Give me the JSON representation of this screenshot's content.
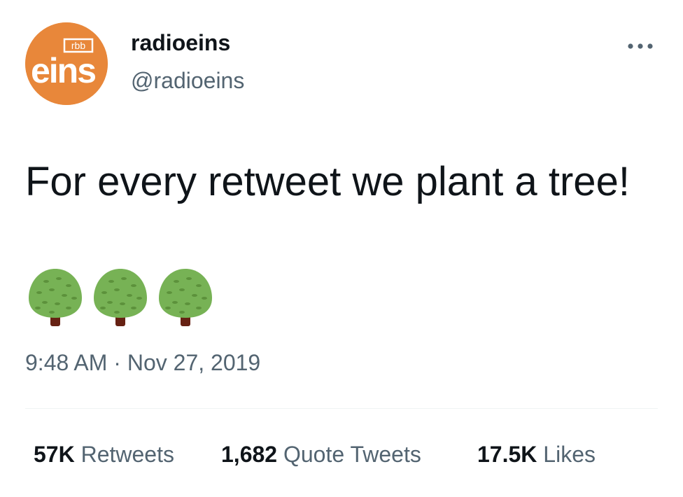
{
  "tweet": {
    "avatar_label": "radioeins logo",
    "avatar_small_text": "rbb",
    "avatar_text": "eins",
    "display_name": "radioeins",
    "handle": "@radioeins",
    "more_icon": "more-horizontal-icon",
    "text": "For every retweet we plant a tree!",
    "emojis": [
      "tree-icon",
      "tree-icon",
      "tree-icon"
    ],
    "time": "9:48 AM",
    "separator": "·",
    "date": "Nov 27, 2019"
  },
  "stats": {
    "retweets": {
      "count": "57K",
      "label": "Retweets"
    },
    "quote_tweets": {
      "count": "1,682",
      "label": "Quote Tweets"
    },
    "likes": {
      "count": "17.5K",
      "label": "Likes"
    }
  },
  "colors": {
    "avatar_bg": "#e8873a",
    "text_primary": "#0f1419",
    "text_secondary": "#536471",
    "tree_crown": "#77b255",
    "tree_trunk": "#662113"
  }
}
